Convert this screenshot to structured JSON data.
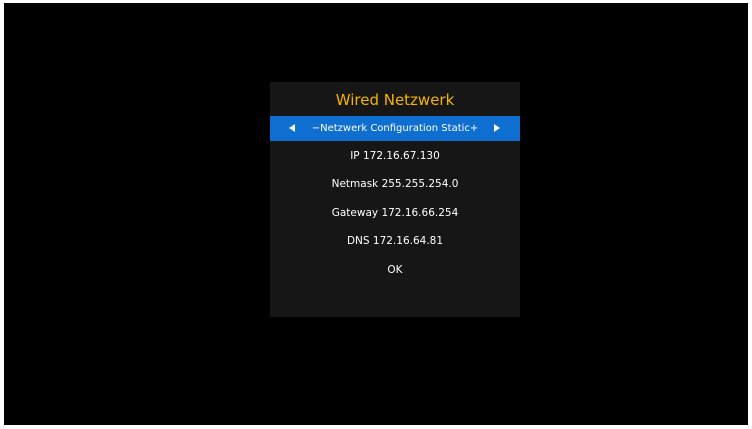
{
  "dialog": {
    "title": "Wired Netzwerk",
    "config_row": {
      "label": "−Netzwerk Configuration Static+",
      "left_icon": "triangle-left-icon",
      "right_icon": "triangle-right-icon"
    },
    "fields": {
      "ip": "IP 172.16.67.130",
      "netmask": "Netmask 255.255.254.0",
      "gateway": "Gateway 172.16.66.254",
      "dns": "DNS 172.16.64.81"
    },
    "ok_label": "OK"
  },
  "colors": {
    "background": "#000000",
    "dialog_background": "#161616",
    "title": "#f6b400",
    "selection": "#0f6fd0",
    "text": "#ffffff"
  }
}
